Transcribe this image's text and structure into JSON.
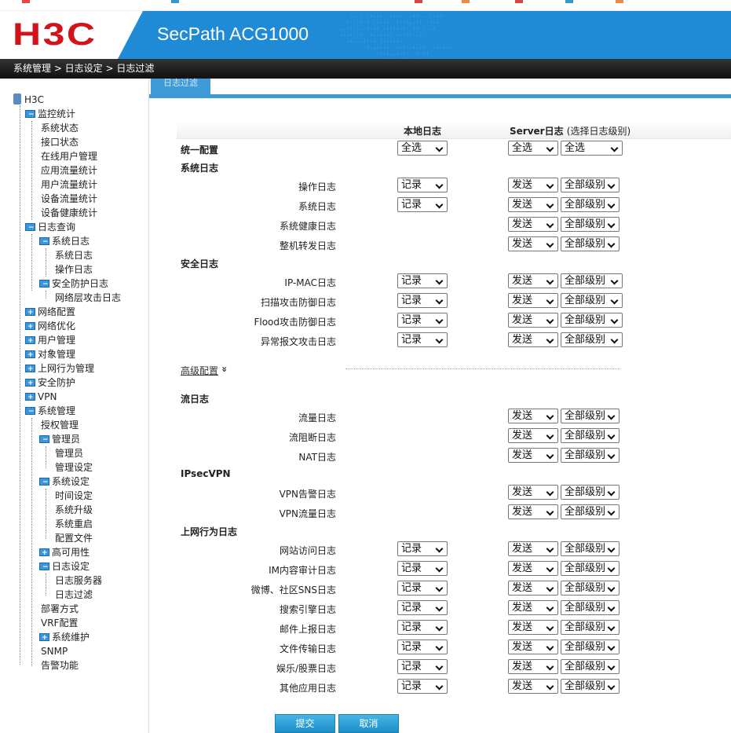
{
  "brand": {
    "logo": "H3C",
    "product": "SecPath ACG1000"
  },
  "breadcrumb": {
    "text": "系统管理 > 日志设定 > 日志过滤"
  },
  "tab": {
    "label": "日志过滤"
  },
  "tree": {
    "root": "H3C",
    "items": [
      {
        "label": "监控统计"
      },
      {
        "label": "系统状态"
      },
      {
        "label": "接口状态"
      },
      {
        "label": "在线用户管理"
      },
      {
        "label": "应用流量统计"
      },
      {
        "label": "用户流量统计"
      },
      {
        "label": "设备流量统计"
      },
      {
        "label": "设备健康统计"
      },
      {
        "label": "日志查询"
      },
      {
        "label": "系统日志"
      },
      {
        "label": "系统日志"
      },
      {
        "label": "操作日志"
      },
      {
        "label": "安全防护日志"
      },
      {
        "label": "网络层攻击日志"
      },
      {
        "label": "网络配置"
      },
      {
        "label": "网络优化"
      },
      {
        "label": "用户管理"
      },
      {
        "label": "对象管理"
      },
      {
        "label": "上网行为管理"
      },
      {
        "label": "安全防护"
      },
      {
        "label": "VPN"
      },
      {
        "label": "系统管理"
      },
      {
        "label": "授权管理"
      },
      {
        "label": "管理员"
      },
      {
        "label": "管理员"
      },
      {
        "label": "管理设定"
      },
      {
        "label": "系统设定"
      },
      {
        "label": "时间设定"
      },
      {
        "label": "系统升级"
      },
      {
        "label": "系统重启"
      },
      {
        "label": "配置文件"
      },
      {
        "label": "高可用性"
      },
      {
        "label": "日志设定"
      },
      {
        "label": "日志服务器"
      },
      {
        "label": "日志过滤"
      },
      {
        "label": "部署方式"
      },
      {
        "label": "VRF配置"
      },
      {
        "label": "系统维护"
      },
      {
        "label": "SNMP"
      },
      {
        "label": "告警功能"
      }
    ]
  },
  "table": {
    "col_local": "本地日志",
    "col_server": "Server日志",
    "col_server_note": "(选择日志级别)"
  },
  "unified": {
    "label": "统一配置",
    "local": "全选",
    "server": "全选",
    "level": "全选"
  },
  "sections": {
    "system": "系统日志",
    "security": "安全日志",
    "flow": "流日志",
    "ipsec": "IPsecVPN",
    "behavior": "上网行为日志"
  },
  "rows": {
    "op": {
      "label": "操作日志",
      "local": "记录",
      "server": "发送",
      "level": "全部级别"
    },
    "sys": {
      "label": "系统日志",
      "local": "记录",
      "server": "发送",
      "level": "全部级别"
    },
    "health": {
      "label": "系统健康日志",
      "server": "发送",
      "level": "全部级别"
    },
    "fwd": {
      "label": "整机转发日志",
      "server": "发送",
      "level": "全部级别"
    },
    "ipmac": {
      "label": "IP-MAC日志",
      "local": "记录",
      "server": "发送",
      "level": "全部级别"
    },
    "scan": {
      "label": "扫描攻击防御日志",
      "local": "记录",
      "server": "发送",
      "level": "全部级别"
    },
    "flood": {
      "label": "Flood攻击防御日志",
      "local": "记录",
      "server": "发送",
      "level": "全部级别"
    },
    "abn": {
      "label": "异常报文攻击日志",
      "local": "记录",
      "server": "发送",
      "level": "全部级别"
    },
    "flow": {
      "label": "流量日志",
      "server": "发送",
      "level": "全部级别"
    },
    "block": {
      "label": "流阻断日志",
      "server": "发送",
      "level": "全部级别"
    },
    "nat": {
      "label": "NAT日志",
      "server": "发送",
      "level": "全部级别"
    },
    "vpnalarm": {
      "label": "VPN告警日志",
      "server": "发送",
      "level": "全部级别"
    },
    "vpnflow": {
      "label": "VPN流量日志",
      "server": "发送",
      "level": "全部级别"
    },
    "web": {
      "label": "网站访问日志",
      "local": "记录",
      "server": "发送",
      "level": "全部级别"
    },
    "im": {
      "label": "IM内容审计日志",
      "local": "记录",
      "server": "发送",
      "level": "全部级别"
    },
    "sns": {
      "label": "微博、社区SNS日志",
      "local": "记录",
      "server": "发送",
      "level": "全部级别"
    },
    "search": {
      "label": "搜索引擎日志",
      "local": "记录",
      "server": "发送",
      "level": "全部级别"
    },
    "mail": {
      "label": "邮件上报日志",
      "local": "记录",
      "server": "发送",
      "level": "全部级别"
    },
    "file": {
      "label": "文件传输日志",
      "local": "记录",
      "server": "发送",
      "level": "全部级别"
    },
    "ent": {
      "label": "娱乐/股票日志",
      "local": "记录",
      "server": "发送",
      "level": "全部级别"
    },
    "other": {
      "label": "其他应用日志",
      "local": "记录",
      "server": "发送",
      "level": "全部级别"
    }
  },
  "advanced": {
    "label": "高级配置",
    "icon": "double-chevron-down-icon",
    "glyph": "»"
  },
  "actions": {
    "submit": "提交",
    "cancel": "取消"
  },
  "colors": {
    "brand_red": "#d2131b",
    "banner_blue": "#1f8ad6",
    "button_blue": "#1c8fc9"
  }
}
